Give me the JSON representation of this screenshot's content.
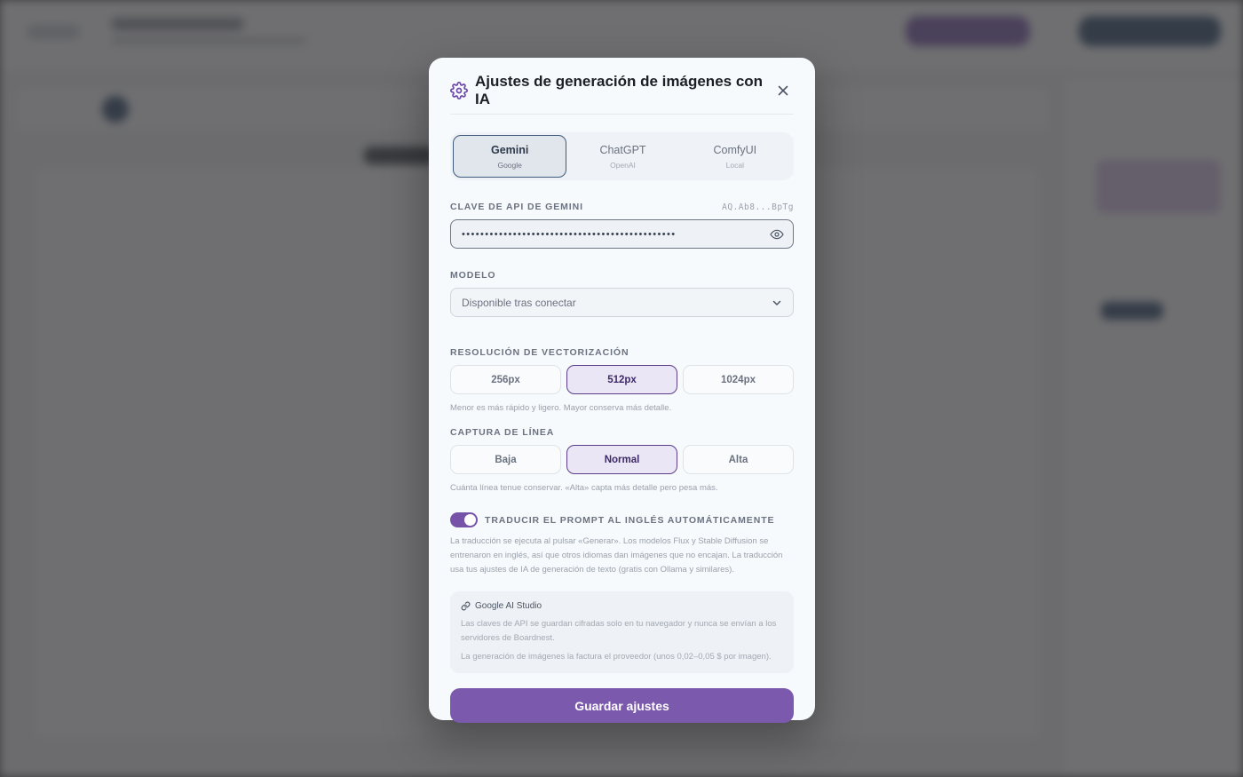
{
  "modal": {
    "title": "Ajustes de generación de imágenes con IA",
    "close_icon": "close-icon",
    "gear_icon": "gear-icon"
  },
  "providers": [
    {
      "name": "Gemini",
      "sub": "Google",
      "active": true
    },
    {
      "name": "ChatGPT",
      "sub": "OpenAI",
      "active": false
    },
    {
      "name": "ComfyUI",
      "sub": "Local",
      "active": false
    }
  ],
  "api_key": {
    "label": "CLAVE DE API DE GEMINI",
    "preview": "AQ.Ab8...BpTg",
    "value": "••••••••••••••••••••••••••••••••••••••••••••••",
    "eye_icon": "eye-icon"
  },
  "model": {
    "label": "MODELO",
    "value": "Disponible tras conectar"
  },
  "resolution": {
    "label": "RESOLUCIÓN DE VECTORIZACIÓN",
    "options": [
      "256px",
      "512px",
      "1024px"
    ],
    "selected": "512px",
    "help": "Menor es más rápido y ligero. Mayor conserva más detalle."
  },
  "line_capture": {
    "label": "CAPTURA DE LÍNEA",
    "options": [
      "Baja",
      "Normal",
      "Alta"
    ],
    "selected": "Normal",
    "help": "Cuánta línea tenue conservar. «Alta» capta más detalle pero pesa más."
  },
  "translate": {
    "label": "TRADUCIR EL PROMPT AL INGLÉS AUTOMÁTICAMENTE",
    "enabled": true,
    "help": "La traducción se ejecuta al pulsar «Generar». Los modelos Flux y Stable Diffusion se entrenaron en inglés, así que otros idiomas dan imágenes que no encajan. La traducción usa tus ajustes de IA de generación de texto (gratis con Ollama y similares)."
  },
  "info": {
    "link": "Google AI Studio",
    "link_icon": "link-icon",
    "text1": "Las claves de API se guardan cifradas solo en tu navegador y nunca se envían a los servidores de Boardnest.",
    "text2": "La generación de imágenes la factura el proveedor (unos 0,02–0,05 $ por imagen)."
  },
  "save_label": "Guardar ajustes",
  "colors": {
    "accent": "#7b5aad",
    "active_tab_border": "#3e5a7a"
  }
}
